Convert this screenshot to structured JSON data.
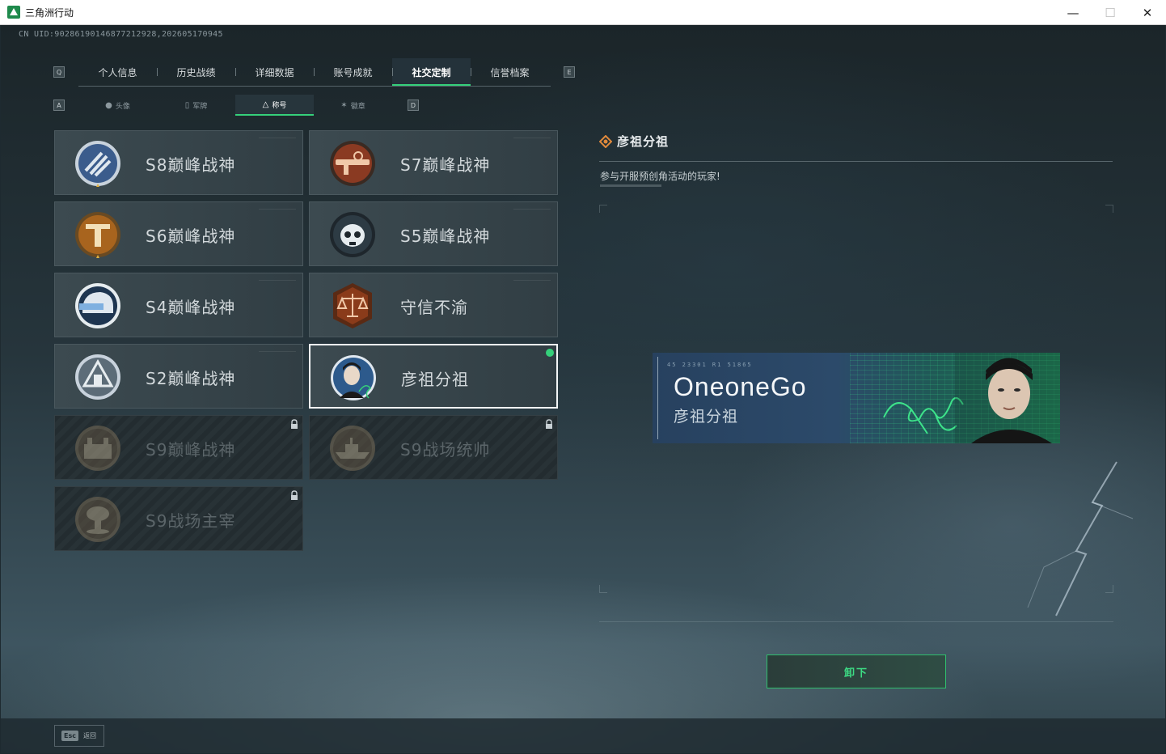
{
  "window": {
    "title": "三角洲行动",
    "minimize": "—",
    "maximize": "☐",
    "close": "✕"
  },
  "uid_text": "CN UID:9028619014687721292​8,202605170945",
  "key_hints": {
    "prev_main": "Q",
    "next_main": "E",
    "prev_sub": "A",
    "next_sub": "D"
  },
  "main_tabs": [
    {
      "label": "个人信息",
      "active": false
    },
    {
      "label": "历史战绩",
      "active": false
    },
    {
      "label": "详细数据",
      "active": false
    },
    {
      "label": "账号成就",
      "active": false
    },
    {
      "label": "社交定制",
      "active": true
    },
    {
      "label": "信誉档案",
      "active": false
    }
  ],
  "sub_tabs": [
    {
      "label": "头像",
      "icon": "person-icon",
      "active": false
    },
    {
      "label": "军牌",
      "icon": "dogtag-icon",
      "active": false
    },
    {
      "label": "称号",
      "icon": "title-icon",
      "active": true
    },
    {
      "label": "徽章",
      "icon": "emblem-icon",
      "active": false
    }
  ],
  "titles": [
    {
      "label": "S8巅峰战神",
      "state": "unlocked",
      "badge": "stripes-badge-icon",
      "badge_color": "#3b5c8c"
    },
    {
      "label": "S7巅峰战神",
      "state": "unlocked",
      "badge": "rifle-badge-icon",
      "badge_color": "#8a3a22"
    },
    {
      "label": "S6巅峰战神",
      "state": "unlocked",
      "badge": "t-shield-badge-icon",
      "badge_color": "#a8641e"
    },
    {
      "label": "S5巅峰战神",
      "state": "unlocked",
      "badge": "skull-badge-icon",
      "badge_color": "#2d3b44"
    },
    {
      "label": "S4巅峰战神",
      "state": "unlocked",
      "badge": "helmet-badge-icon",
      "badge_color": "#1e3550"
    },
    {
      "label": "守信不渝",
      "state": "unlocked",
      "badge": "scales-badge-icon",
      "badge_color": "#8a3b1a"
    },
    {
      "label": "S2巅峰战神",
      "state": "unlocked",
      "badge": "tower-badge-icon",
      "badge_color": "#5c6c78"
    },
    {
      "label": "彦祖分祖",
      "state": "equipped",
      "badge": "portrait-badge-icon",
      "badge_color": "#2d5a8c"
    },
    {
      "label": "S9巅峰战神",
      "state": "locked",
      "badge": "fortress-badge-icon",
      "badge_color": "#6b5a44"
    },
    {
      "label": "S9战场统帅",
      "state": "locked",
      "badge": "ship-badge-icon",
      "badge_color": "#6b5a44"
    },
    {
      "label": "S9战场主宰",
      "state": "locked",
      "badge": "mushroom-cloud-badge-icon",
      "badge_color": "#6b5a44"
    }
  ],
  "detail": {
    "title": "彦祖分祖",
    "description": "参与开服预创角活动的玩家!",
    "nameplate": {
      "player_name": "OneoneGo",
      "title": "彦祖分祖",
      "codes": "45 23301   R1 51865"
    }
  },
  "unequip_button": "卸下",
  "esc_hint": {
    "key": "Esc",
    "label": "返回"
  },
  "colors": {
    "accent": "#35d07a",
    "selected_border": "#f2f5f6"
  }
}
